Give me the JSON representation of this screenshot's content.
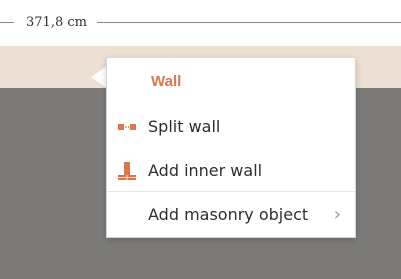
{
  "dimension": {
    "label": "371,8 cm"
  },
  "context_menu": {
    "title": "Wall",
    "items": [
      {
        "label": "Split wall",
        "icon": "split-wall-icon"
      },
      {
        "label": "Add inner wall",
        "icon": "inner-wall-icon"
      },
      {
        "label": "Add masonry object",
        "icon": "chevron-right-icon"
      }
    ]
  },
  "colors": {
    "accent": "#d9774a",
    "wall_band": "#ece0d4",
    "floor": "#7c7b79"
  }
}
